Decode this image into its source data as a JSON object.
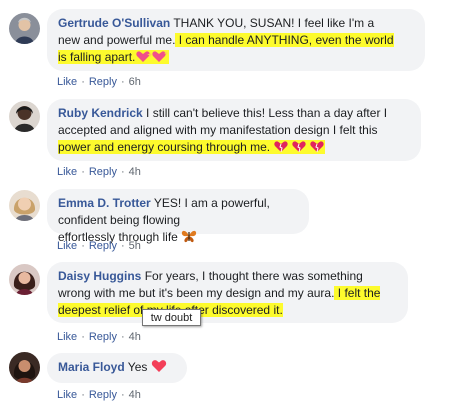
{
  "comments": [
    {
      "author": "Gertrude O'Sullivan",
      "lines": [
        {
          "before": " THANK YOU, SUSAN! I feel like I'm a",
          "hl": ""
        },
        {
          "before": "new and powerful me.",
          "hl": " I can handle ANYTHING, even the world"
        },
        {
          "before": "",
          "hl": "is falling apart."
        }
      ],
      "emoji": "heart-sparkle-icon",
      "like": "Like",
      "reply": "Reply",
      "time": "6h"
    },
    {
      "author": "Ruby Kendrick",
      "lines": [
        {
          "before": " I still can't believe this! Less than a day after I",
          "hl": ""
        },
        {
          "before": "accepted and aligned with my manifestation design I felt this",
          "hl": ""
        },
        {
          "before": "",
          "hl": "power and energy coursing through me."
        }
      ],
      "emoji": "broken-heart-icon",
      "like": "Like",
      "reply": "Reply",
      "time": "4h"
    },
    {
      "author": "Emma D. Trotter",
      "lines": [
        {
          "before": " YES! I am a powerful, confident being flowing",
          "hl": ""
        },
        {
          "before": "effortlessly through life",
          "hl": ""
        }
      ],
      "emoji": "butterfly-icon",
      "like": "Like",
      "reply": "Reply",
      "time": "5h"
    },
    {
      "author": "Daisy Huggins",
      "lines": [
        {
          "before": " For years, I thought there was something",
          "hl": ""
        },
        {
          "before": "wrong with me but it's been my design and my aura.",
          "hl": " I felt the"
        },
        {
          "before": "",
          "hl": "deepest relief of my life after discovered it."
        }
      ],
      "like": "Like",
      "reply": "Reply",
      "time": "4h"
    },
    {
      "author": "Maria Floyd",
      "lines": [
        {
          "before": " Yes",
          "hl": ""
        }
      ],
      "emoji": "heart-icon",
      "like": "Like",
      "reply": "Reply",
      "time": "4h"
    }
  ],
  "tooltip": "tw doubt",
  "colors": {
    "name": "#385898",
    "bubble": "#f2f3f5",
    "highlight": "#fdfb2d",
    "meta": "#606770"
  }
}
